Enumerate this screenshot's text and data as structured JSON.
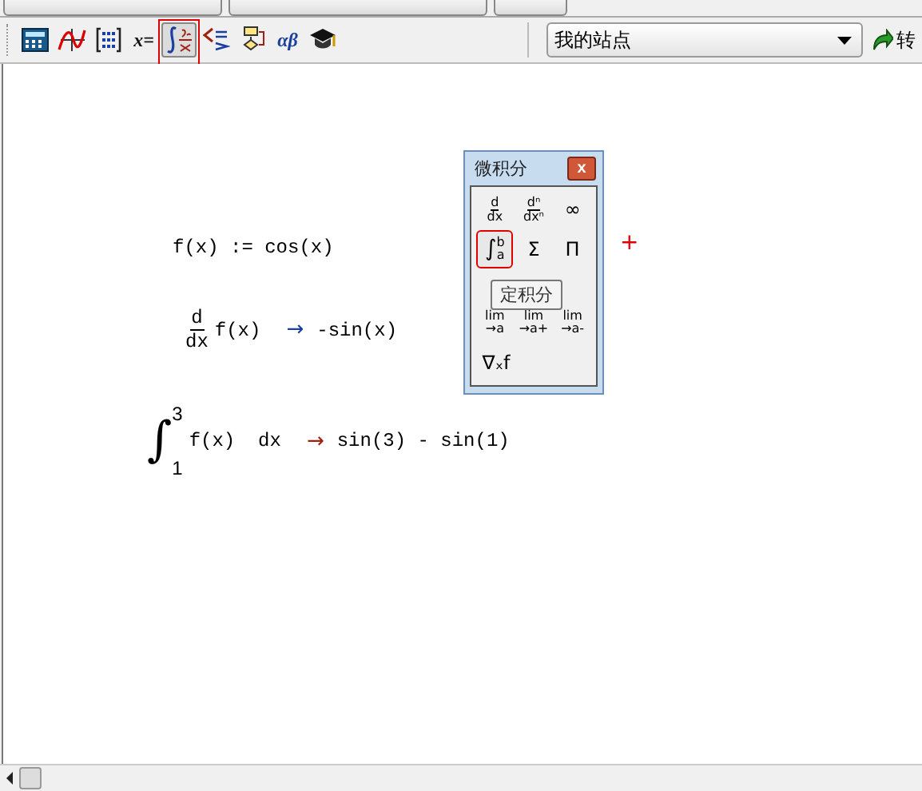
{
  "toolbar": {
    "tools": [
      {
        "kind": "calculator",
        "selected": false
      },
      {
        "kind": "graph",
        "selected": false
      },
      {
        "kind": "matrix",
        "selected": false
      },
      {
        "kind": "evaluation",
        "label": "x=",
        "selected": false
      },
      {
        "kind": "calculus",
        "selected": true,
        "highlighted": true
      },
      {
        "kind": "boolean",
        "selected": false
      },
      {
        "kind": "programming",
        "selected": false
      },
      {
        "kind": "greek",
        "label": "αβ",
        "selected": false
      },
      {
        "kind": "symbolic",
        "selected": false
      }
    ],
    "address": {
      "value": "我的站点"
    },
    "go_button": {
      "label": "转"
    }
  },
  "worksheet": {
    "regions": [
      {
        "kind": "definition",
        "text": "f(x) := cos(x)"
      },
      {
        "kind": "derivative",
        "numerator": "d",
        "denominator": "dx",
        "body": "f(x)",
        "arrow": "→",
        "result": "-sin(x)"
      },
      {
        "kind": "integral",
        "sign": "∫",
        "upper": "3",
        "lower": "1",
        "body": "f(x)  dx",
        "arrow": "→",
        "result": "sin(3) - sin(1)"
      }
    ],
    "cursor": "+"
  },
  "palette": {
    "title": "微积分",
    "close": "x",
    "rows": [
      [
        {
          "kind": "fraction",
          "top": "d",
          "bottom": "dx",
          "highlighted": false
        },
        {
          "kind": "fraction",
          "top": "dⁿ",
          "bottom": "dxⁿ",
          "highlighted": false
        },
        {
          "kind": "text",
          "text": "∞",
          "highlighted": false
        }
      ],
      [
        {
          "kind": "integral",
          "sign": "∫",
          "top": "b",
          "bottom": "a",
          "highlighted": true
        },
        {
          "kind": "text",
          "text": "Σ",
          "highlighted": false
        },
        {
          "kind": "text",
          "text": "Π",
          "highlighted": false
        }
      ],
      [
        {
          "kind": "limit",
          "top": "lim",
          "bottom": "→a",
          "highlighted": false
        },
        {
          "kind": "limit",
          "top": "lim",
          "bottom": "→a+",
          "highlighted": false
        },
        {
          "kind": "limit",
          "top": "lim",
          "bottom": "→a-",
          "highlighted": false
        }
      ],
      [
        {
          "kind": "text",
          "text": "∇ₓf",
          "highlighted": false
        }
      ]
    ],
    "tooltip": "定积分"
  }
}
